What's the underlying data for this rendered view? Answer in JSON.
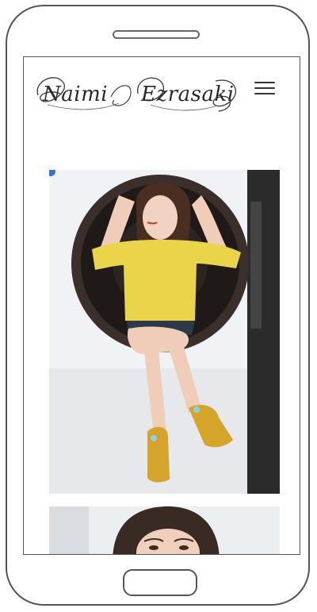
{
  "header": {
    "logo_first": "Naimi",
    "logo_last": "Ezrasaki"
  },
  "colors": {
    "accent_yellow": "#e9d44a",
    "shoe_mustard": "#d4a42b",
    "frame": "#555555"
  },
  "icons": {
    "menu": "hamburger-icon"
  }
}
